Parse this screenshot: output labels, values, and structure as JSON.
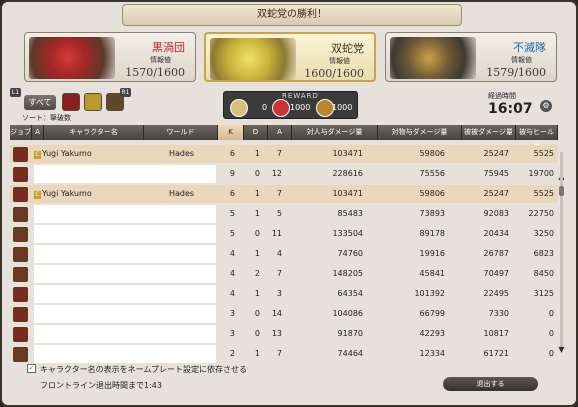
{
  "title": "双蛇党の勝利！",
  "teams": [
    {
      "name": "黒渦団",
      "sub": "情報値",
      "score": "1570/1600",
      "name_color": "#c0202a"
    },
    {
      "name": "双蛇党",
      "sub": "情報値",
      "score": "1600/1600",
      "name_color": "#3a3a1a"
    },
    {
      "name": "不滅隊",
      "sub": "情報値",
      "score": "1579/1600",
      "name_color": "#1d68b8"
    }
  ],
  "filters": {
    "all_label": "すべて",
    "badge_left": "L1",
    "badge_right": "R1"
  },
  "sort_label": "ソート：撃破数",
  "reward": {
    "label": "REWARD",
    "values": [
      "0",
      "1000",
      "1000"
    ]
  },
  "elapsed": {
    "label": "経過時間",
    "value": "16:07"
  },
  "columns": [
    "ジョブ",
    "A",
    "キャラクター名",
    "ワールド",
    "K",
    "D",
    "A",
    "対人与ダメージ量",
    "対物与ダメージ量",
    "被被ダメージ量",
    "被与ヒール量"
  ],
  "rows": [
    {
      "name": "Yugi Yakumo",
      "world": "Hades",
      "k": "6",
      "d": "1",
      "a": "7",
      "pvp": "103471",
      "obj": "59806",
      "taken": "25247",
      "heal": "5525",
      "hl": true
    },
    {
      "name": "",
      "world": "",
      "k": "9",
      "d": "0",
      "a": "12",
      "pvp": "228616",
      "obj": "75556",
      "taken": "75945",
      "heal": "19700",
      "hl": false
    },
    {
      "name": "Yugi Yakumo",
      "world": "Hades",
      "k": "6",
      "d": "1",
      "a": "7",
      "pvp": "103471",
      "obj": "59806",
      "taken": "25247",
      "heal": "5525",
      "hl": true
    },
    {
      "name": "",
      "world": "",
      "k": "5",
      "d": "1",
      "a": "5",
      "pvp": "85483",
      "obj": "73893",
      "taken": "92083",
      "heal": "22750",
      "hl": false
    },
    {
      "name": "",
      "world": "",
      "k": "5",
      "d": "0",
      "a": "11",
      "pvp": "133504",
      "obj": "89178",
      "taken": "20434",
      "heal": "3250",
      "hl": false
    },
    {
      "name": "",
      "world": "",
      "k": "4",
      "d": "1",
      "a": "4",
      "pvp": "74760",
      "obj": "19916",
      "taken": "26787",
      "heal": "6823",
      "hl": false
    },
    {
      "name": "",
      "world": "",
      "k": "4",
      "d": "2",
      "a": "7",
      "pvp": "148205",
      "obj": "45841",
      "taken": "70497",
      "heal": "8450",
      "hl": false
    },
    {
      "name": "",
      "world": "",
      "k": "4",
      "d": "1",
      "a": "3",
      "pvp": "64354",
      "obj": "101392",
      "taken": "22495",
      "heal": "3125",
      "hl": false
    },
    {
      "name": "",
      "world": "",
      "k": "3",
      "d": "0",
      "a": "14",
      "pvp": "104086",
      "obj": "66799",
      "taken": "7330",
      "heal": "0",
      "hl": false
    },
    {
      "name": "",
      "world": "",
      "k": "3",
      "d": "0",
      "a": "13",
      "pvp": "91870",
      "obj": "42293",
      "taken": "10817",
      "heal": "0",
      "hl": false
    },
    {
      "name": "",
      "world": "",
      "k": "2",
      "d": "1",
      "a": "7",
      "pvp": "74464",
      "obj": "12334",
      "taken": "61721",
      "heal": "0",
      "hl": false
    }
  ],
  "checkbox_label": "キャラクター名の表示をネームプレート設定に依存させる",
  "leave_text": "フロントライン退出時間まで1:43",
  "exit_button": "退出する"
}
